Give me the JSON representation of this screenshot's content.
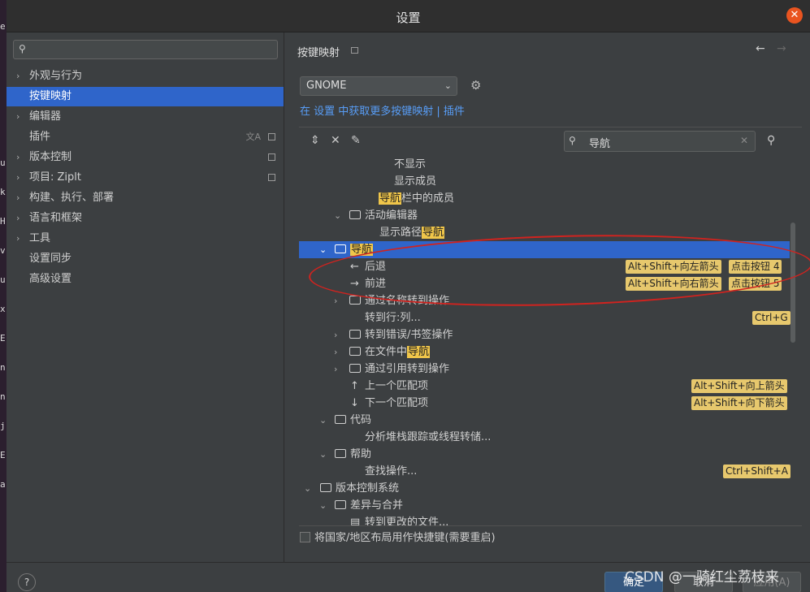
{
  "window": {
    "title": "设置",
    "close_icon": "close-icon"
  },
  "desk_letters": [
    "e",
    "u",
    "k",
    "H",
    "v",
    "u",
    "x",
    "E",
    "n",
    "n",
    "j",
    "E",
    "a"
  ],
  "left": {
    "search_placeholder": "",
    "items": [
      {
        "label": "外观与行为",
        "expandable": true
      },
      {
        "label": "按键映射",
        "expandable": false,
        "selected": true
      },
      {
        "label": "编辑器",
        "expandable": true
      },
      {
        "label": "插件",
        "expandable": false,
        "badge": true,
        "lang_icon": "文A"
      },
      {
        "label": "版本控制",
        "expandable": true,
        "badge": true
      },
      {
        "label": "项目: Ziplt",
        "expandable": true,
        "badge": true
      },
      {
        "label": "构建、执行、部署",
        "expandable": true
      },
      {
        "label": "语言和框架",
        "expandable": true
      },
      {
        "label": "工具",
        "expandable": true
      },
      {
        "label": "设置同步",
        "expandable": false
      },
      {
        "label": "高级设置",
        "expandable": false
      }
    ]
  },
  "right": {
    "title": "按键映射",
    "keymap": "GNOME",
    "link_text": "在 设置 中获取更多按键映射 | 插件",
    "search_value": "导航",
    "tree": [
      {
        "text": "不显示"
      },
      {
        "text": "显示成员"
      },
      {
        "pre": "",
        "hl": "导航",
        "post": "栏中的成员"
      },
      {
        "text": "活动编辑器"
      },
      {
        "pre": "显示路径",
        "hl": "导航",
        "post": ""
      },
      {
        "pre": "",
        "hl": "导航",
        "post": ""
      },
      {
        "text": "后退",
        "sc1": "Alt+Shift+向左箭头",
        "sc2": "点击按钮 4"
      },
      {
        "text": "前进",
        "sc1": "Alt+Shift+向右箭头",
        "sc2": "点击按钮 5"
      },
      {
        "text": "通过名称转到操作"
      },
      {
        "text": "转到行:列...",
        "sc1": "Ctrl+G"
      },
      {
        "text": "转到错误/书签操作"
      },
      {
        "pre": "在文件中",
        "hl": "导航",
        "post": ""
      },
      {
        "text": "通过引用转到操作"
      },
      {
        "text": "上一个匹配项",
        "sc1": "Alt+Shift+向上箭头"
      },
      {
        "text": "下一个匹配项",
        "sc1": "Alt+Shift+向下箭头"
      },
      {
        "text": "代码"
      },
      {
        "text": "分析堆栈跟踪或线程转储..."
      },
      {
        "text": "帮助"
      },
      {
        "text": "查找操作...",
        "sc1": "Ctrl+Shift+A"
      },
      {
        "text": "版本控制系统"
      },
      {
        "text": "差异与合并"
      },
      {
        "text": "转到更改的文件..."
      }
    ],
    "bottom_checkbox": "将国家/地区布局用作快捷键(需要重启)"
  },
  "footer": {
    "help": "?",
    "ok": "确定",
    "cancel": "取消",
    "apply": "应用(A)",
    "watermark": "CSDN @一骑红尘荔枝来"
  },
  "colors": {
    "accent": "#2f65ca",
    "link": "#589df6",
    "highlight": "#f0c64a",
    "annotation": "#d0231f"
  }
}
